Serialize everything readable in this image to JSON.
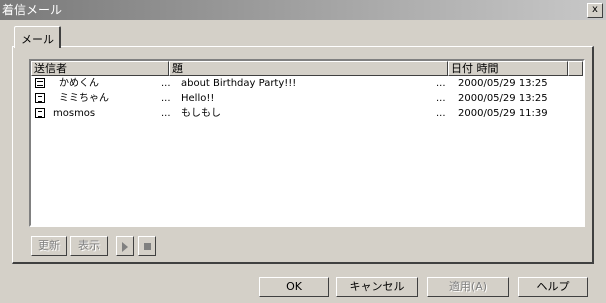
{
  "window": {
    "title": "着信メール",
    "close_label": "x"
  },
  "tabs": [
    {
      "label": "メール"
    }
  ],
  "columns": [
    {
      "label": "送信者"
    },
    {
      "label": "題"
    },
    {
      "label": "日付 時間"
    }
  ],
  "messages": [
    {
      "icon": "mail-icon",
      "sender": "かめくん",
      "subject": "about Birthday Party!!!",
      "date": "2000/05/29 13:25"
    },
    {
      "icon": "document-icon",
      "sender": "ミミちゃん",
      "subject": "Hello!!",
      "date": "2000/05/29 13:25"
    },
    {
      "icon": "document-icon",
      "sender": "mosmos",
      "subject": "もしもし",
      "date": "2000/05/29 11:39"
    }
  ],
  "ellipsis": "...",
  "toolbar": {
    "refresh_label": "更新",
    "display_label": "表示",
    "play_icon": "play-icon",
    "stop_icon": "stop-icon"
  },
  "footer": {
    "ok_label": "OK",
    "cancel_label": "キャンセル",
    "apply_label": "適用(A)",
    "help_label": "ヘルプ"
  }
}
